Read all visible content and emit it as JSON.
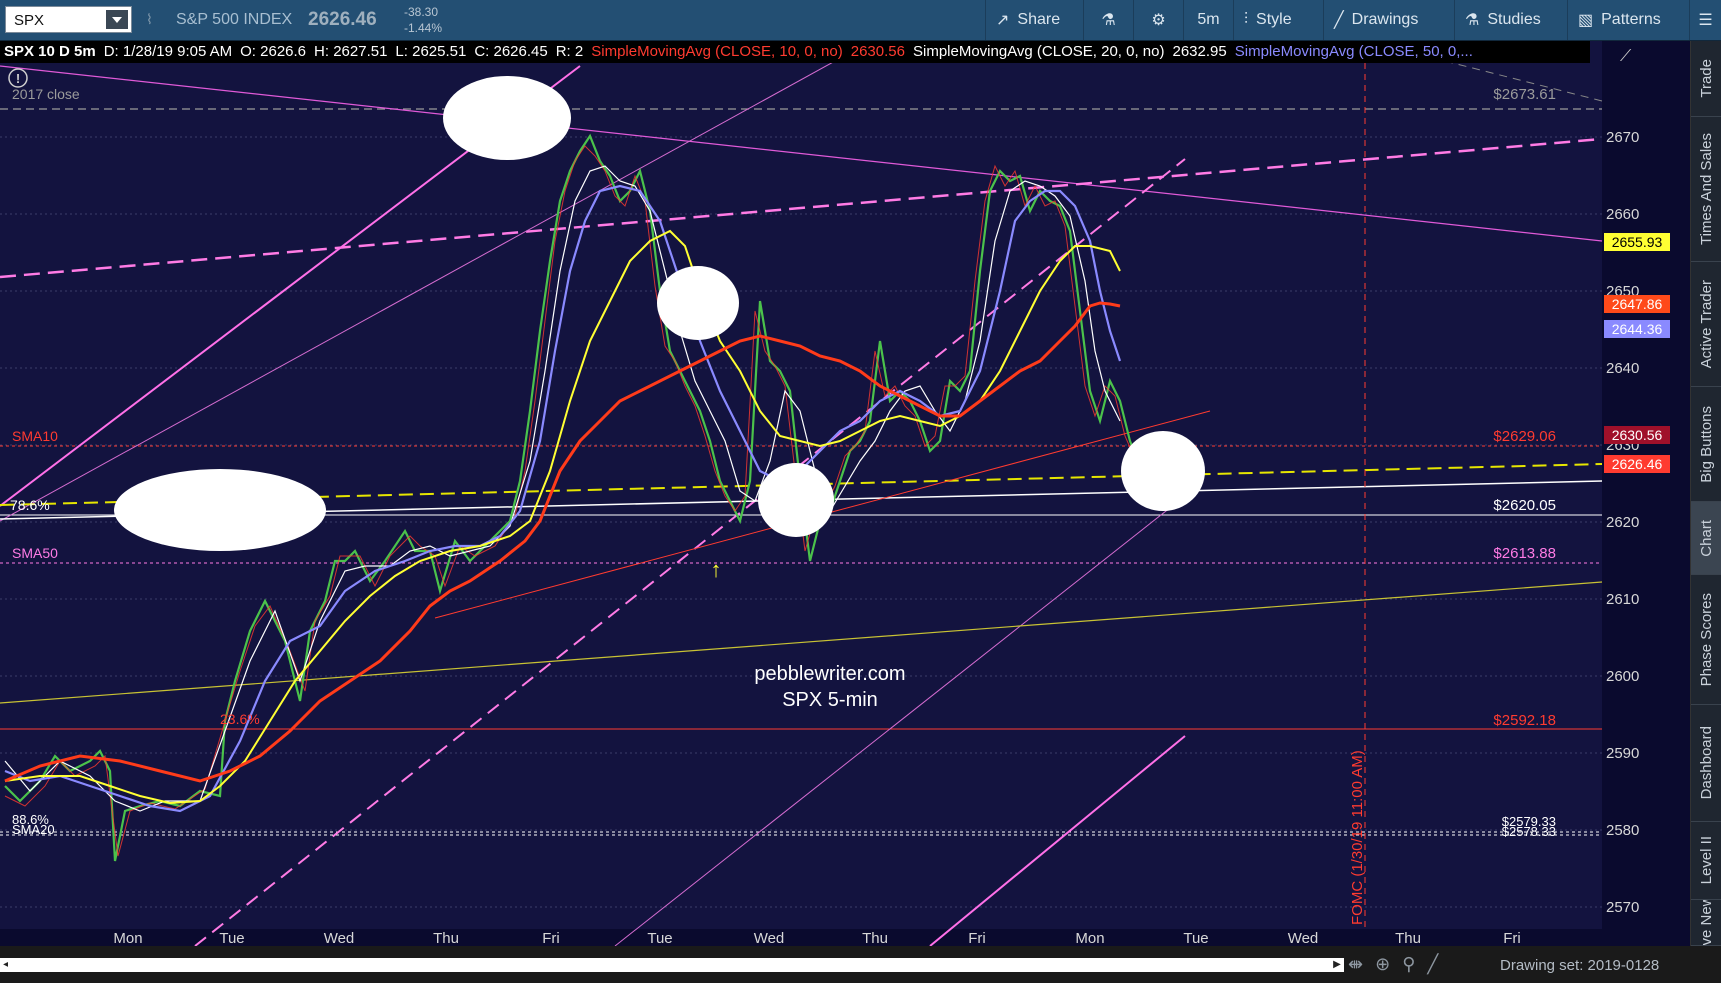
{
  "toolbar": {
    "symbol": "SPX",
    "index_name": "S&P 500 INDEX",
    "price": "2626.46",
    "change": "-38.30",
    "change_pct": "-1.44%",
    "share_label": "Share",
    "timeframe_label": "5m",
    "style_label": "Style",
    "drawings_label": "Drawings",
    "studies_label": "Studies",
    "patterns_label": "Patterns"
  },
  "studies": {
    "header": "SPX 10 D 5m",
    "date": "D: 1/28/19 9:05 AM",
    "open": "O: 2626.6",
    "high": "H: 2627.51",
    "low": "L: 2625.51",
    "close": "C: 2626.45",
    "r": "R: 2",
    "sma10_label": "SimpleMovingAvg (CLOSE, 10, 0, no)",
    "sma10_value": "2630.56",
    "sma20_label": "SimpleMovingAvg (CLOSE, 20, 0, no)",
    "sma20_value": "2632.95",
    "sma50_label": "SimpleMovingAvg (CLOSE, 50, 0,...",
    "colors": {
      "sma10": "#ff3b30",
      "sma20": "#ffffff",
      "sma50": "#8a8aff"
    }
  },
  "chart": {
    "watermark_line1": "pebblewriter.com",
    "watermark_line2": "SPX 5-min",
    "annot_2017_close": "2017 close",
    "annot_786": "78.6%",
    "annot_sma10": "SMA10",
    "annot_sma50": "SMA50",
    "annot_236": "23.6%",
    "annot_886": "88.6%",
    "annot_sma20": "SMA20",
    "fomc_label": "FOMC (1/30/19 11:00 AM)",
    "right_labels": {
      "l2673": "$2673.61",
      "l2629": "$2629.06",
      "l2620": "$2620.05",
      "l2613": "$2613.88",
      "l2592": "$2592.18",
      "l2579a": "$2579.33",
      "l2579b": "$2578.33"
    },
    "badges": {
      "b1": "2655.93",
      "b2": "2647.86",
      "b3": "2644.36",
      "b4": "2630.56",
      "b5": "2626.46"
    },
    "price_axis": [
      "2670",
      "2660",
      "2650",
      "2640",
      "2630",
      "2620",
      "2610",
      "2600",
      "2590",
      "2580",
      "2570"
    ],
    "time_axis": [
      "Mon",
      "Tue",
      "Wed",
      "Thu",
      "Fri",
      "Tue",
      "Wed",
      "Thu",
      "Fri",
      "Mon",
      "Tue",
      "Wed",
      "Thu",
      "Fri"
    ]
  },
  "sidebar": {
    "tabs": [
      "Trade",
      "Times And Sales",
      "Active Trader",
      "Big Buttons",
      "Chart",
      "Phase Scores",
      "Dashboard",
      "Level II",
      "Live News"
    ]
  },
  "bottom": {
    "drawing_set": "Drawing set: 2019-0128"
  }
}
